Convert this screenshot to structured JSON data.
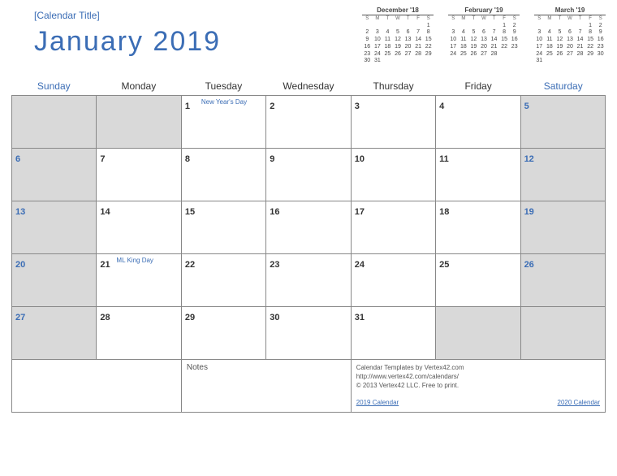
{
  "header": {
    "calendar_title": "[Calendar Title]",
    "main_title": "January  2019"
  },
  "mini_calendars": [
    {
      "title": "December '18",
      "dow": [
        "S",
        "M",
        "T",
        "W",
        "T",
        "F",
        "S"
      ],
      "rows": [
        [
          "",
          "",
          "",
          "",
          "",
          "",
          "1"
        ],
        [
          "2",
          "3",
          "4",
          "5",
          "6",
          "7",
          "8"
        ],
        [
          "9",
          "10",
          "11",
          "12",
          "13",
          "14",
          "15"
        ],
        [
          "16",
          "17",
          "18",
          "19",
          "20",
          "21",
          "22"
        ],
        [
          "23",
          "24",
          "25",
          "26",
          "27",
          "28",
          "29"
        ],
        [
          "30",
          "31",
          "",
          "",
          "",
          "",
          ""
        ]
      ]
    },
    {
      "title": "February '19",
      "dow": [
        "S",
        "M",
        "T",
        "W",
        "T",
        "F",
        "S"
      ],
      "rows": [
        [
          "",
          "",
          "",
          "",
          "",
          "1",
          "2"
        ],
        [
          "3",
          "4",
          "5",
          "6",
          "7",
          "8",
          "9"
        ],
        [
          "10",
          "11",
          "12",
          "13",
          "14",
          "15",
          "16"
        ],
        [
          "17",
          "18",
          "19",
          "20",
          "21",
          "22",
          "23"
        ],
        [
          "24",
          "25",
          "26",
          "27",
          "28",
          "",
          ""
        ]
      ]
    },
    {
      "title": "March '19",
      "dow": [
        "S",
        "M",
        "T",
        "W",
        "T",
        "F",
        "S"
      ],
      "rows": [
        [
          "",
          "",
          "",
          "",
          "",
          "1",
          "2"
        ],
        [
          "3",
          "4",
          "5",
          "6",
          "7",
          "8",
          "9"
        ],
        [
          "10",
          "11",
          "12",
          "13",
          "14",
          "15",
          "16"
        ],
        [
          "17",
          "18",
          "19",
          "20",
          "21",
          "22",
          "23"
        ],
        [
          "24",
          "25",
          "26",
          "27",
          "28",
          "29",
          "30"
        ],
        [
          "31",
          "",
          "",
          "",
          "",
          "",
          ""
        ]
      ]
    }
  ],
  "dow": [
    "Sunday",
    "Monday",
    "Tuesday",
    "Wednesday",
    "Thursday",
    "Friday",
    "Saturday"
  ],
  "weeks": [
    [
      {
        "day": "",
        "shaded": true
      },
      {
        "day": "",
        "shaded": true
      },
      {
        "day": "1",
        "event": "New Year's Day"
      },
      {
        "day": "2"
      },
      {
        "day": "3"
      },
      {
        "day": "4"
      },
      {
        "day": "5",
        "weekend": true,
        "shaded": true
      }
    ],
    [
      {
        "day": "6",
        "weekend": true,
        "shaded": true
      },
      {
        "day": "7"
      },
      {
        "day": "8"
      },
      {
        "day": "9"
      },
      {
        "day": "10"
      },
      {
        "day": "11"
      },
      {
        "day": "12",
        "weekend": true,
        "shaded": true
      }
    ],
    [
      {
        "day": "13",
        "weekend": true,
        "shaded": true
      },
      {
        "day": "14"
      },
      {
        "day": "15"
      },
      {
        "day": "16"
      },
      {
        "day": "17"
      },
      {
        "day": "18"
      },
      {
        "day": "19",
        "weekend": true,
        "shaded": true
      }
    ],
    [
      {
        "day": "20",
        "weekend": true,
        "shaded": true
      },
      {
        "day": "21",
        "event": "ML King Day"
      },
      {
        "day": "22"
      },
      {
        "day": "23"
      },
      {
        "day": "24"
      },
      {
        "day": "25"
      },
      {
        "day": "26",
        "weekend": true,
        "shaded": true
      }
    ],
    [
      {
        "day": "27",
        "weekend": true,
        "shaded": true
      },
      {
        "day": "28"
      },
      {
        "day": "29"
      },
      {
        "day": "30"
      },
      {
        "day": "31"
      },
      {
        "day": "",
        "shaded": true
      },
      {
        "day": "",
        "shaded": true
      }
    ]
  ],
  "footer": {
    "notes_label": "Notes",
    "credit_line1": "Calendar Templates by Vertex42.com",
    "credit_line2": "http://www.vertex42.com/calendars/",
    "credit_line3": "© 2013 Vertex42 LLC. Free to print.",
    "link1": "2019 Calendar",
    "link2": "2020 Calendar"
  }
}
